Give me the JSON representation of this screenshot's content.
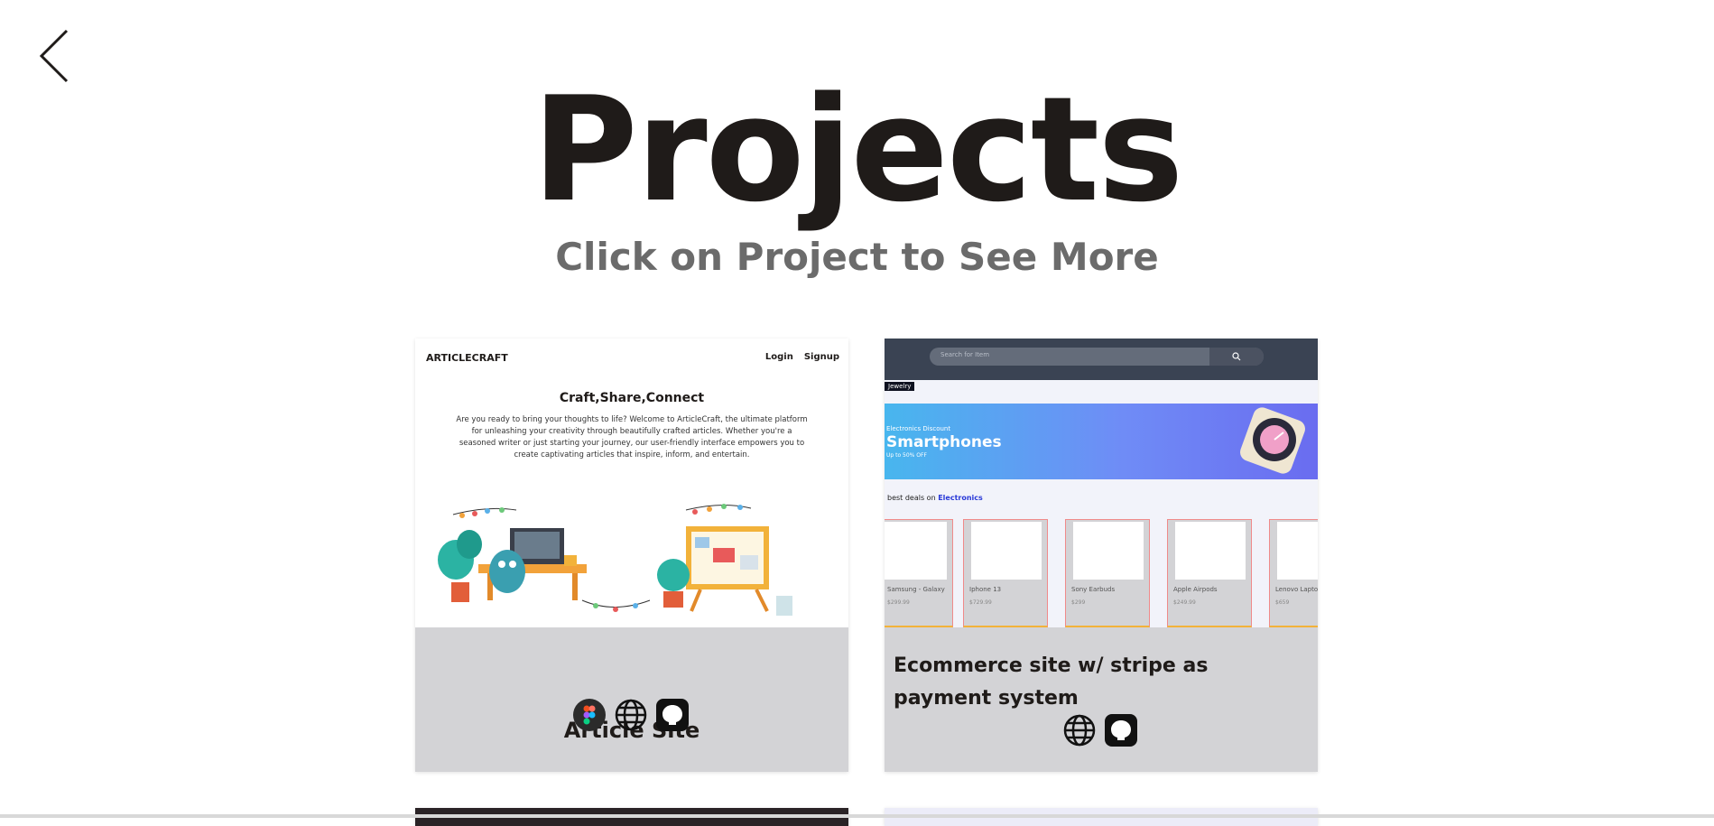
{
  "header": {
    "title": "Projects",
    "subtitle": "Click on Project to See More"
  },
  "projects": [
    {
      "title": "Article Site",
      "preview": {
        "brand": "ARTICLECRAFT",
        "nav": [
          "Login",
          "Signup"
        ],
        "heading": "Craft,Share,Connect",
        "paragraph": "Are you ready to bring your thoughts to life? Welcome to ArticleCraft, the ultimate platform for unleashing your creativity through beautifully crafted articles. Whether you're a seasoned writer or just starting your journey, our user-friendly interface empowers you to create captivating articles that inspire, inform, and entertain."
      },
      "icons": [
        "figma-icon",
        "globe-icon",
        "github-icon"
      ]
    },
    {
      "title": "Ecommerce site w/ stripe as payment system",
      "preview": {
        "search_placeholder": "Search for Item",
        "category": "Jewelry",
        "banner_small": "Electronics Discount",
        "banner_title": "Smartphones",
        "banner_tiny": "Up to 50% OFF",
        "deals_prefix": "best deals on",
        "deals_link": "Electronics",
        "products": [
          {
            "name": "Samsung - Galaxy",
            "price": "$299.99"
          },
          {
            "name": "Iphone 13",
            "price": "$729.99"
          },
          {
            "name": "Sony Earbuds",
            "price": "$299"
          },
          {
            "name": "Apple Airpods",
            "price": "$249.99"
          },
          {
            "name": "Lenovo Laptop",
            "price": "$659"
          }
        ]
      },
      "icons": [
        "globe-icon",
        "github-icon"
      ]
    }
  ],
  "colors": {
    "title": "#1f1b19",
    "subtitle": "#6b6b6b",
    "card_bg": "#d3d3d6",
    "banner_from": "#48b6ee",
    "banner_to": "#6a6cf0"
  }
}
